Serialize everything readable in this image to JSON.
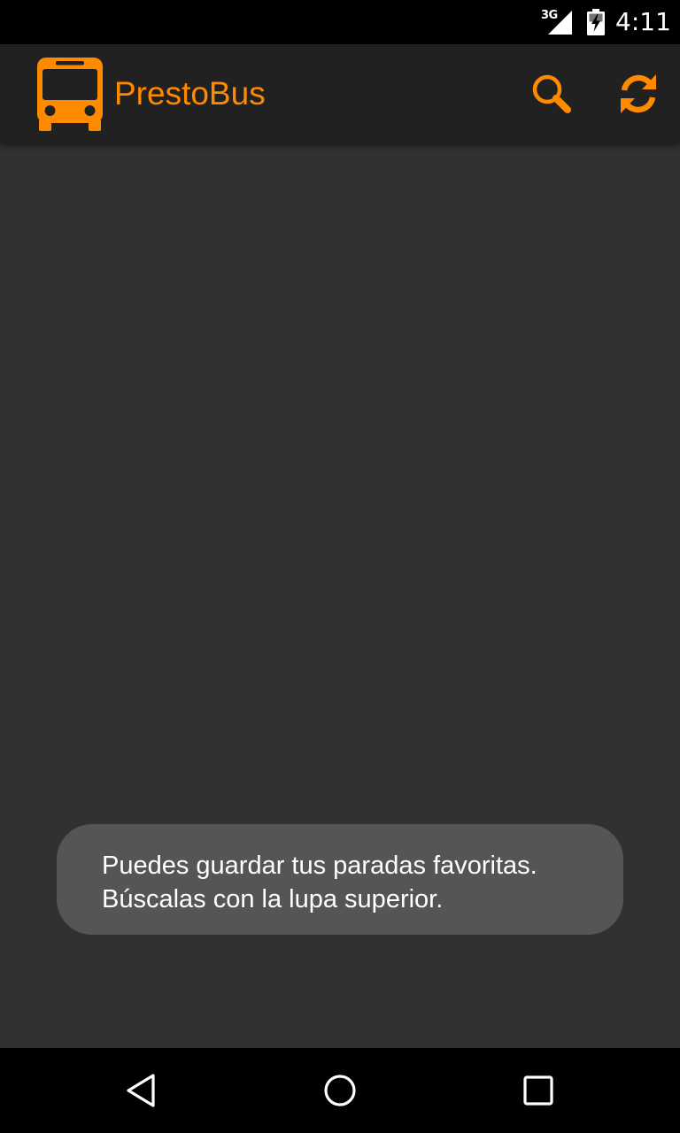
{
  "status_bar": {
    "network": "3G",
    "time": "4:11"
  },
  "app_bar": {
    "title": "PrestoBus",
    "logo_icon": "bus-icon",
    "actions": [
      {
        "icon": "search-icon"
      },
      {
        "icon": "refresh-icon"
      }
    ]
  },
  "toast": {
    "line1": "Puedes guardar tus paradas favoritas.",
    "line2": "Búscalas con la lupa superior."
  },
  "nav_bar": {
    "buttons": [
      {
        "icon": "back-icon"
      },
      {
        "icon": "home-icon"
      },
      {
        "icon": "recents-icon"
      }
    ]
  },
  "colors": {
    "accent": "#ff8a00",
    "app_bar": "#212121",
    "background": "#313131",
    "toast": "#555555"
  }
}
